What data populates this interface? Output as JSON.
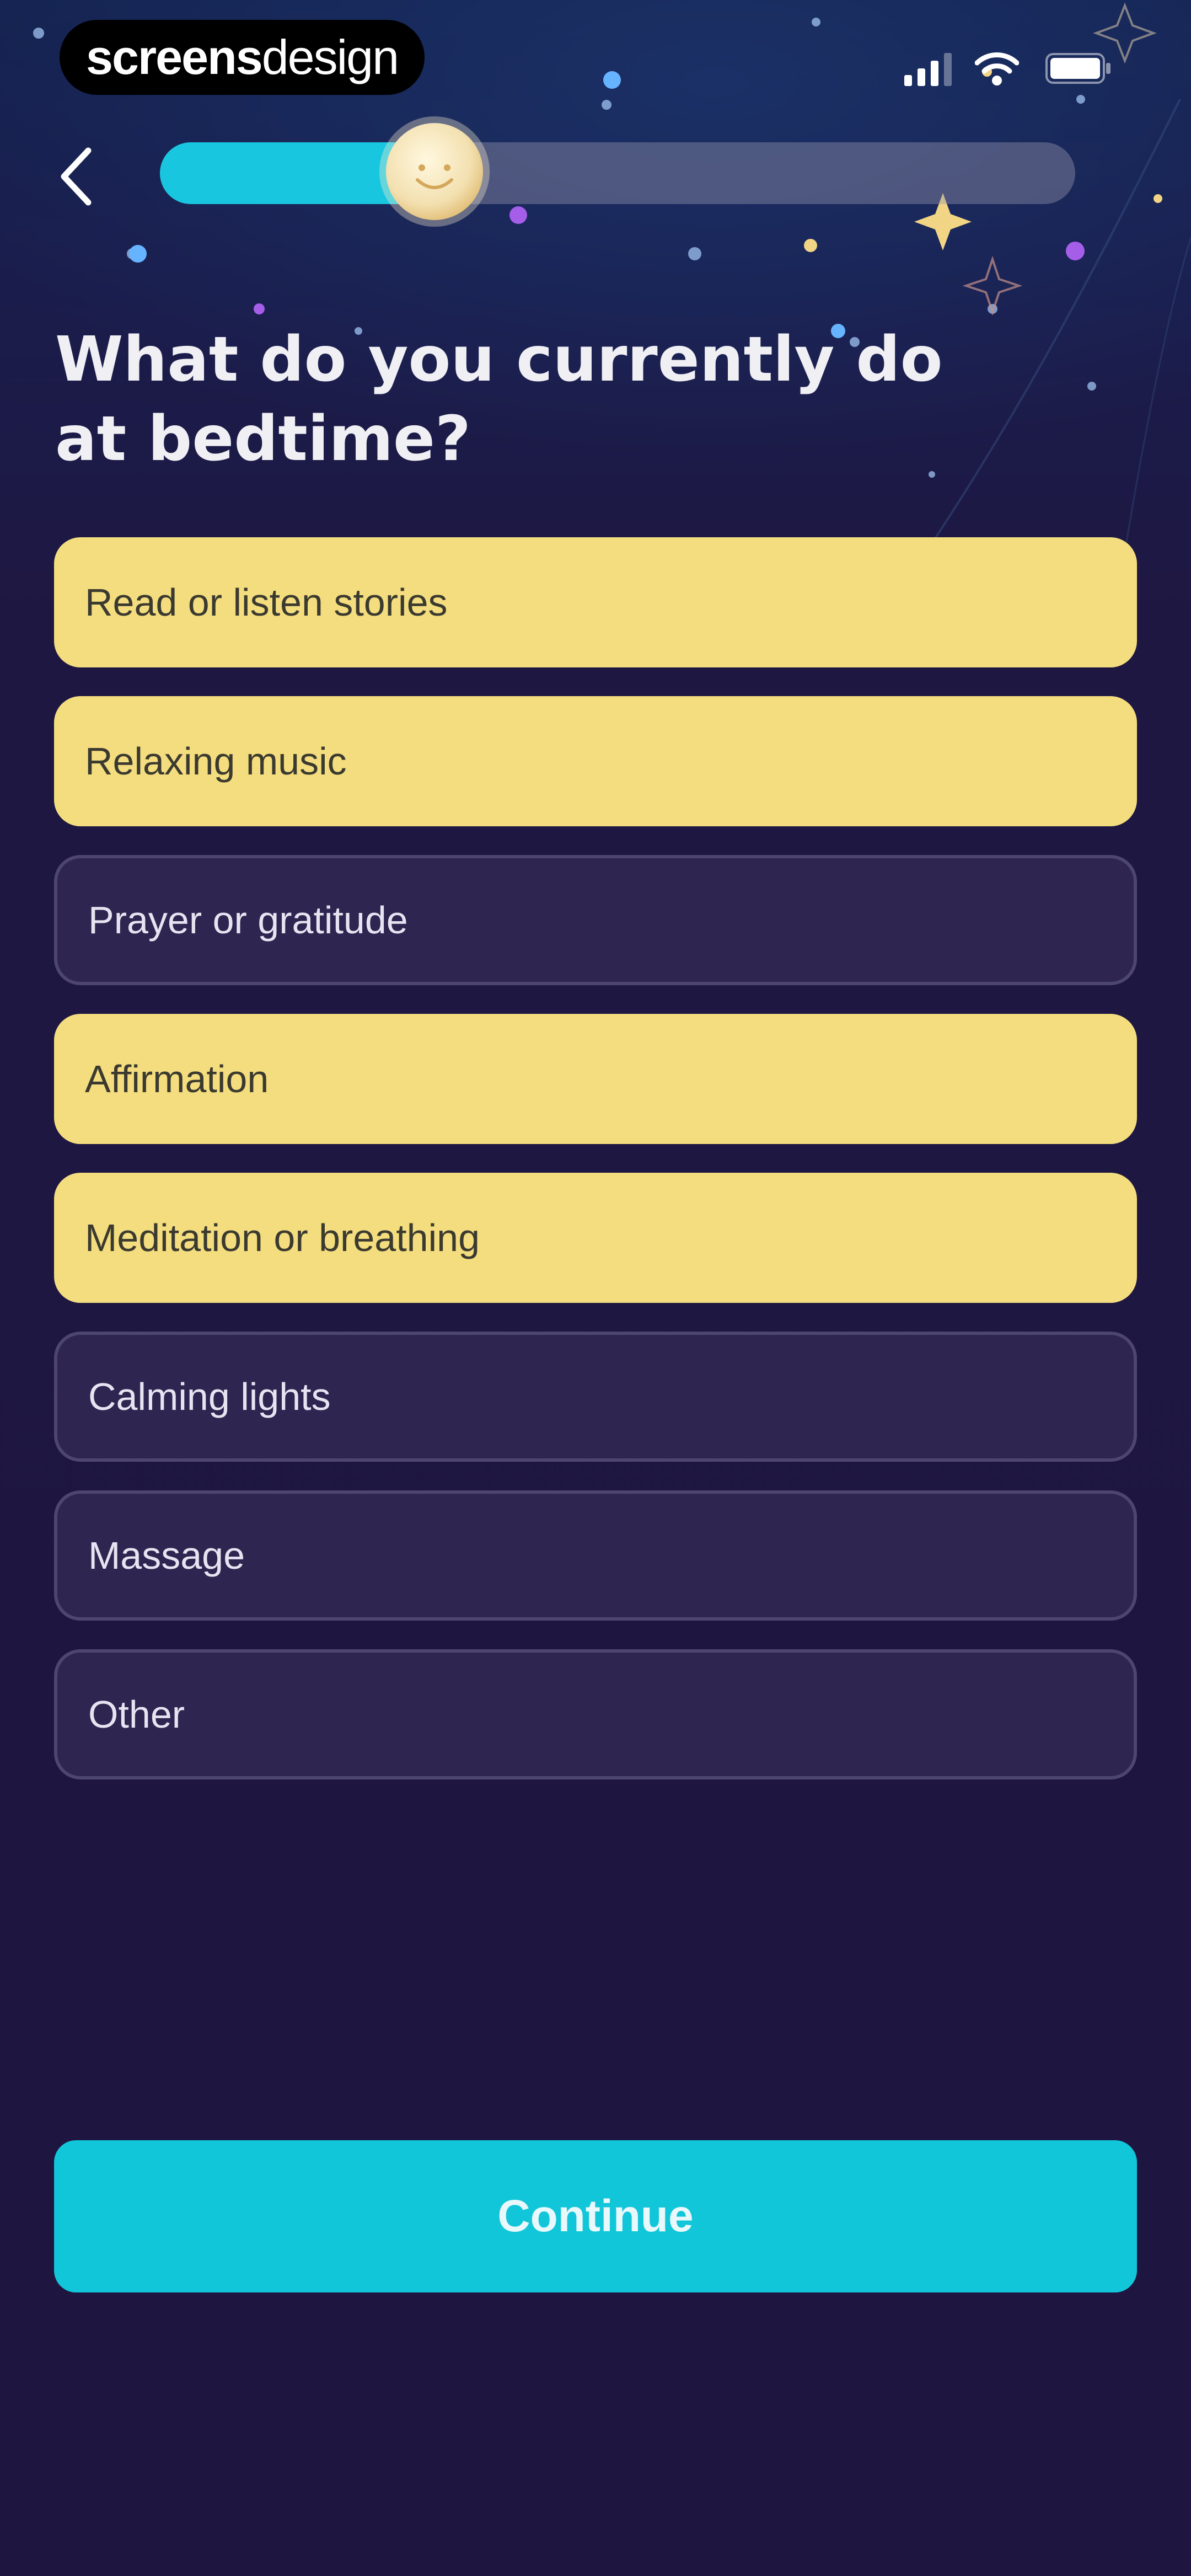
{
  "app": {
    "watermark_bold": "screens",
    "watermark_light": "design"
  },
  "status_bar": {
    "signal_icon": "signal-bars-icon",
    "wifi_icon": "wifi-icon",
    "battery_icon": "battery-icon"
  },
  "header": {
    "back_icon": "chevron-left-icon",
    "progress": {
      "fraction": 0.3,
      "marker_icon": "moon-icon"
    }
  },
  "question": {
    "title": "What do you currently do at bedtime?"
  },
  "options": [
    {
      "label": "Read or listen stories",
      "selected": true
    },
    {
      "label": "Relaxing music",
      "selected": true
    },
    {
      "label": "Prayer or gratitude",
      "selected": false
    },
    {
      "label": "Affirmation",
      "selected": true
    },
    {
      "label": "Meditation or breathing",
      "selected": true
    },
    {
      "label": "Calming lights",
      "selected": false
    },
    {
      "label": "Massage",
      "selected": false
    },
    {
      "label": "Other",
      "selected": false
    }
  ],
  "footer": {
    "continue_label": "Continue"
  },
  "colors": {
    "background": "#1e1640",
    "accent": "#12c6da",
    "selected_option": "#f4dd7e",
    "unselected_option": "#2e2650"
  }
}
